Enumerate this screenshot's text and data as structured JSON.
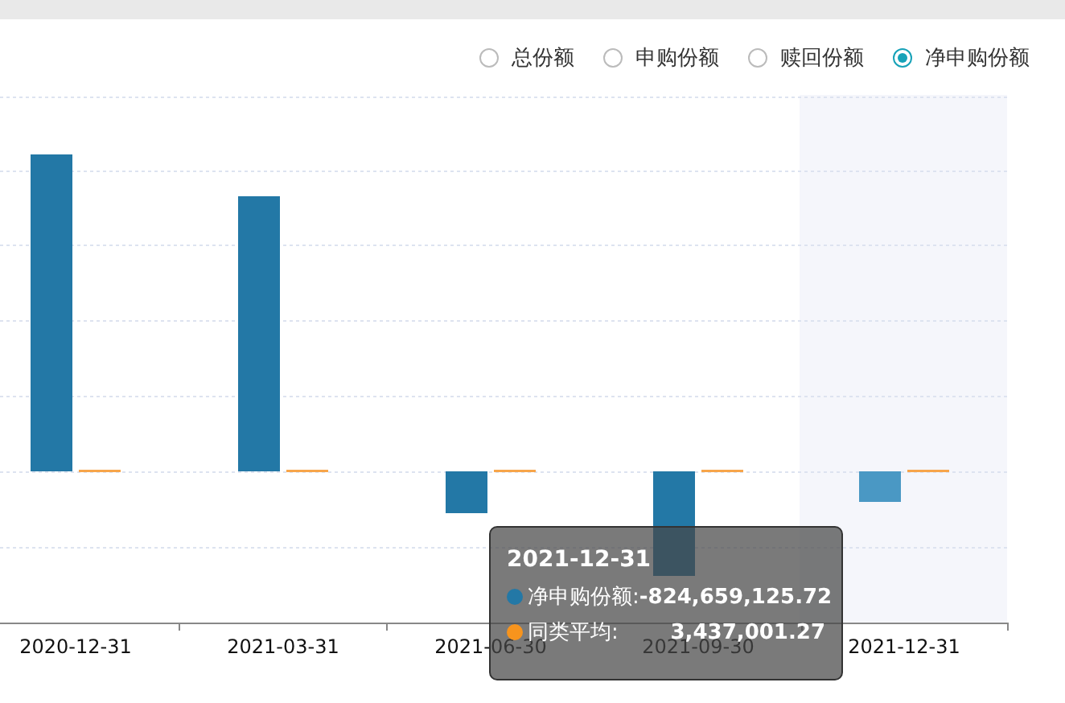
{
  "legend": [
    {
      "label": "总份额",
      "selected": false
    },
    {
      "label": "申购份额",
      "selected": false
    },
    {
      "label": "赎回份额",
      "selected": false
    },
    {
      "label": "净申购份额",
      "selected": true
    }
  ],
  "chart": {
    "x_labels": [
      {
        "label": "2020-12-31",
        "selected": false
      },
      {
        "label": "2021-03-31",
        "selected": false
      },
      {
        "label": "2021-06-30",
        "selected": false
      },
      {
        "label": "2021-09-30",
        "selected": false
      },
      {
        "label": "2021-12-31",
        "selected": true
      }
    ]
  },
  "tooltip": {
    "title": "2021-12-31",
    "rows": [
      {
        "label": "净申购份额:",
        "value": "-824,659,125.72",
        "color": "#2378a6"
      },
      {
        "label": "同类平均:",
        "value": "3,437,001.27",
        "color": "#f7941d"
      }
    ]
  }
}
